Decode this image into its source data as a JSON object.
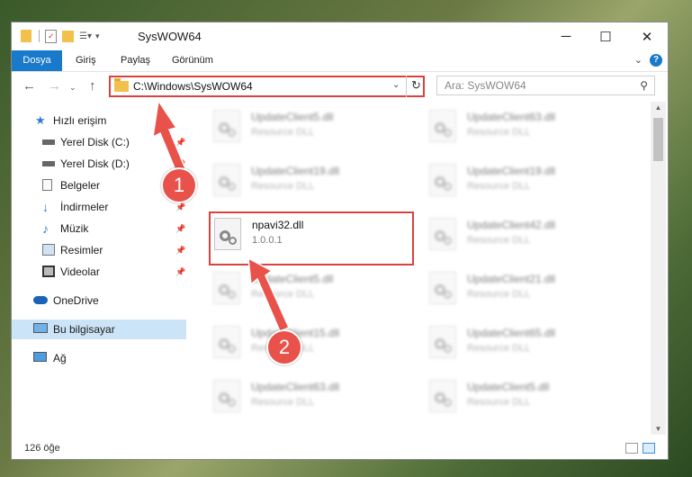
{
  "window": {
    "title": "SysWOW64"
  },
  "ribbon": {
    "tabs": [
      "Dosya",
      "Giriş",
      "Paylaş",
      "Görünüm"
    ],
    "accent": "#1979ca"
  },
  "address": {
    "path": "C:\\Windows\\SysWOW64"
  },
  "search": {
    "placeholder": "Ara: SysWOW64"
  },
  "sidebar": {
    "items": [
      {
        "label": "Hızlı erişim",
        "icon": "star-icon"
      },
      {
        "label": "Yerel Disk (C:)",
        "icon": "drive-icon",
        "pinned": true
      },
      {
        "label": "Yerel Disk (D:)",
        "icon": "drive-icon",
        "pinned": true
      },
      {
        "label": "Belgeler",
        "icon": "documents-icon",
        "pinned": true
      },
      {
        "label": "İndirmeler",
        "icon": "download-icon",
        "pinned": true
      },
      {
        "label": "Müzik",
        "icon": "music-icon",
        "pinned": true
      },
      {
        "label": "Resimler",
        "icon": "pictures-icon",
        "pinned": true
      },
      {
        "label": "Videolar",
        "icon": "video-icon",
        "pinned": true
      },
      {
        "label": "OneDrive",
        "icon": "cloud-icon"
      },
      {
        "label": "Bu bilgisayar",
        "icon": "computer-icon",
        "selected": true
      },
      {
        "label": "Ağ",
        "icon": "network-icon"
      }
    ]
  },
  "files": {
    "left": [
      {
        "name": "UpdateClient5.dll",
        "desc": "Resource DLL"
      },
      {
        "name": "UpdateClient19.dll",
        "desc": "Resource DLL"
      },
      {
        "name": "npavi32.dll",
        "desc": "1.0.0.1",
        "highlighted": true
      },
      {
        "name": "UpdateClient5.dll",
        "desc": "Resource DLL"
      },
      {
        "name": "UpdateClient15.dll",
        "desc": "Resource DLL"
      },
      {
        "name": "UpdateClient63.dll",
        "desc": "Resource DLL"
      }
    ],
    "right": [
      {
        "name": "UpdateClient63.dll",
        "desc": "Resource DLL"
      },
      {
        "name": "UpdateClient19.dll",
        "desc": "Resource DLL"
      },
      {
        "name": "UpdateClient42.dll",
        "desc": "Resource DLL"
      },
      {
        "name": "UpdateClient21.dll",
        "desc": "Resource DLL"
      },
      {
        "name": "UpdateClient65.dll",
        "desc": "Resource DLL"
      },
      {
        "name": "UpdateClient5.dll",
        "desc": "Resource DLL"
      }
    ]
  },
  "status": {
    "count": "126 öğe"
  },
  "annotations": {
    "step1": "1",
    "step2": "2",
    "color": "#e8524a"
  }
}
